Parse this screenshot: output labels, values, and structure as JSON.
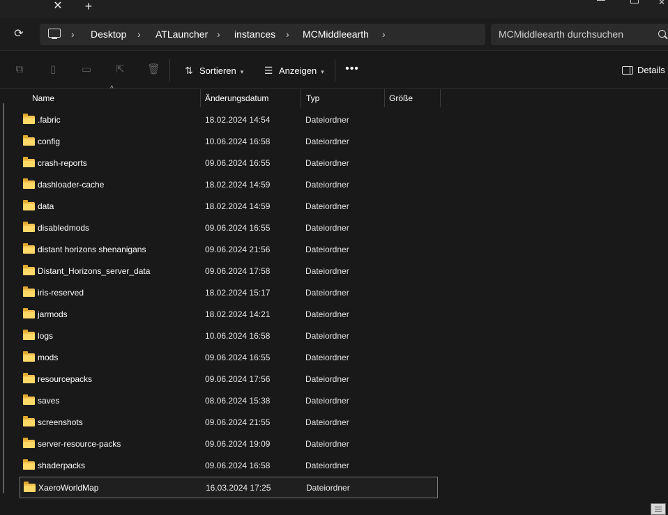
{
  "tabbar": {
    "close_glyph": "✕",
    "new_tab_glyph": "+"
  },
  "window_controls": {
    "close_glyph": "✕"
  },
  "address": {
    "breadcrumbs": [
      "Desktop",
      "ATLauncher",
      "instances",
      "MCMiddleearth"
    ],
    "separator": "›"
  },
  "search": {
    "placeholder": "MCMiddleearth durchsuchen"
  },
  "toolbar": {
    "sort_label": "Sortieren",
    "view_label": "Anzeigen",
    "more_label": "•••",
    "details_label": "Details"
  },
  "columns": {
    "name": "Name",
    "date": "Änderungsdatum",
    "type": "Typ",
    "size": "Größe"
  },
  "files": [
    {
      "name": ".fabric",
      "date": "18.02.2024 14:54",
      "type": "Dateiordner"
    },
    {
      "name": "config",
      "date": "10.06.2024 16:58",
      "type": "Dateiordner"
    },
    {
      "name": "crash-reports",
      "date": "09.06.2024 16:55",
      "type": "Dateiordner"
    },
    {
      "name": "dashloader-cache",
      "date": "18.02.2024 14:59",
      "type": "Dateiordner"
    },
    {
      "name": "data",
      "date": "18.02.2024 14:59",
      "type": "Dateiordner"
    },
    {
      "name": "disabledmods",
      "date": "09.06.2024 16:55",
      "type": "Dateiordner"
    },
    {
      "name": "distant horizons shenanigans",
      "date": "09.06.2024 21:56",
      "type": "Dateiordner"
    },
    {
      "name": "Distant_Horizons_server_data",
      "date": "09.06.2024 17:58",
      "type": "Dateiordner"
    },
    {
      "name": "iris-reserved",
      "date": "18.02.2024 15:17",
      "type": "Dateiordner"
    },
    {
      "name": "jarmods",
      "date": "18.02.2024 14:21",
      "type": "Dateiordner"
    },
    {
      "name": "logs",
      "date": "10.06.2024 16:58",
      "type": "Dateiordner"
    },
    {
      "name": "mods",
      "date": "09.06.2024 16:55",
      "type": "Dateiordner"
    },
    {
      "name": "resourcepacks",
      "date": "09.06.2024 17:56",
      "type": "Dateiordner"
    },
    {
      "name": "saves",
      "date": "08.06.2024 15:38",
      "type": "Dateiordner"
    },
    {
      "name": "screenshots",
      "date": "09.06.2024 21:55",
      "type": "Dateiordner"
    },
    {
      "name": "server-resource-packs",
      "date": "09.06.2024 19:09",
      "type": "Dateiordner"
    },
    {
      "name": "shaderpacks",
      "date": "09.06.2024 16:58",
      "type": "Dateiordner"
    },
    {
      "name": "XaeroWorldMap",
      "date": "16.03.2024 17:25",
      "type": "Dateiordner",
      "selected": true
    }
  ],
  "colors": {
    "background": "#191919",
    "folder": "#ffd968",
    "text": "#ffffff"
  }
}
